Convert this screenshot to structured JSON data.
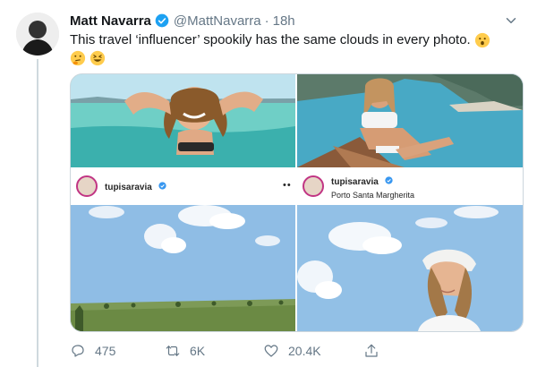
{
  "tweet": {
    "author_name": "Matt Navarra",
    "handle": "@MattNavarra",
    "separator": "·",
    "time": "18h",
    "text": "This travel ‘influencer’ spookily has the same clouds in every photo.",
    "emojis": [
      "hushed-face-emoji",
      "thinking-face-emoji",
      "grinning-squinting-face-emoji"
    ],
    "verified": true
  },
  "media": {
    "left_post": {
      "username": "tupisaravia",
      "location": ""
    },
    "right_post": {
      "username": "tupisaravia",
      "location": "Porto Santa Margherita",
      "more": "••"
    }
  },
  "actions": {
    "reply_count": "475",
    "retweet_count": "6K",
    "like_count": "20.4K"
  },
  "colors": {
    "accent": "#1da1f2",
    "secondary_text": "#657786",
    "sky": "#9fc6ea",
    "sea": "#3fb6b0"
  }
}
